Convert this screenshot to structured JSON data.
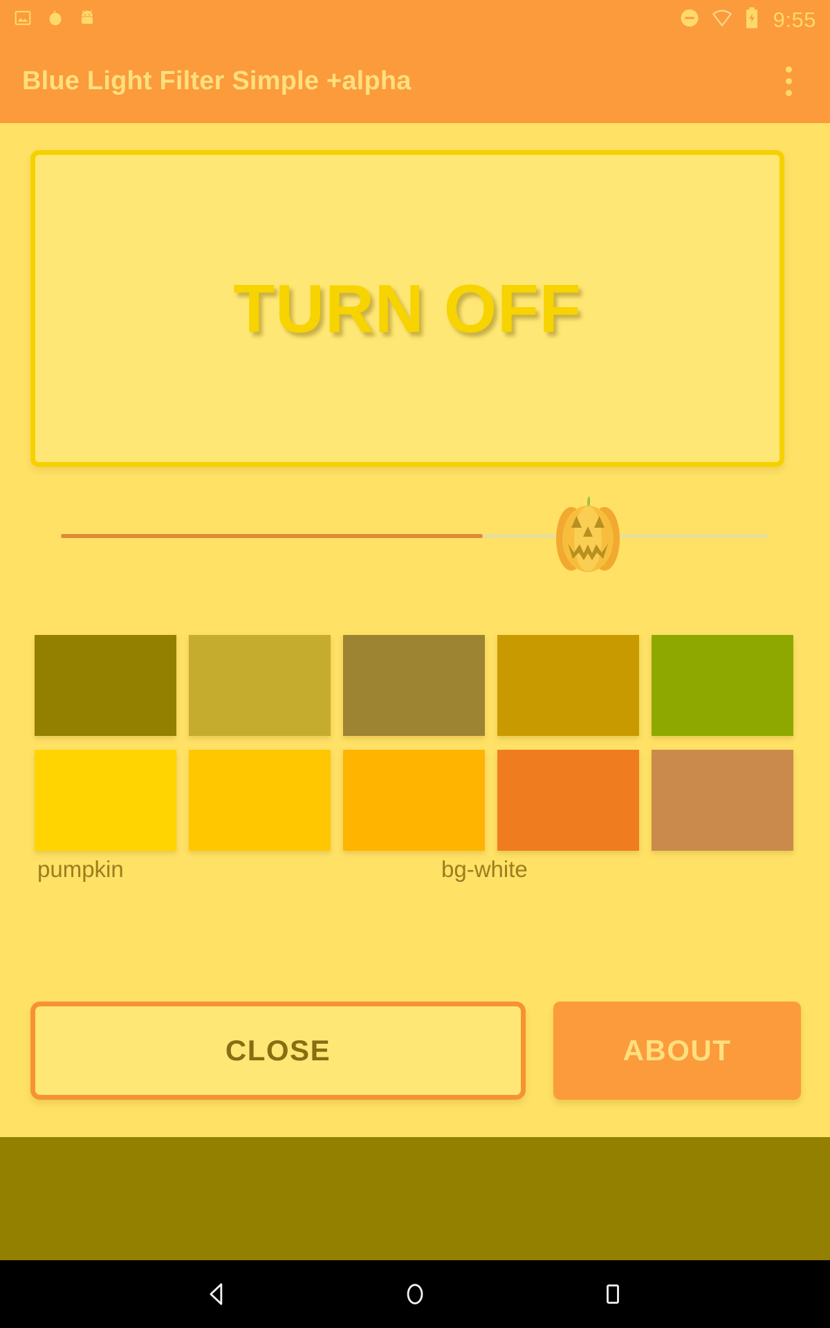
{
  "status_bar": {
    "icons_left": [
      "image-icon",
      "pumpkin-notification-icon",
      "android-robot-icon"
    ],
    "icons_right": [
      "do-not-disturb-icon",
      "wifi-icon",
      "battery-charging-icon"
    ],
    "time": "9:55"
  },
  "app_bar": {
    "title": "Blue Light Filter Simple +alpha",
    "overflow_icon": "more-vert-icon"
  },
  "main": {
    "toggle_button_label": "TURN OFF",
    "slider": {
      "thumb_icon": "jack-o-lantern-icon",
      "fill_percent": 60,
      "fill_color": "#E08A38",
      "track_color": "#EADE93"
    },
    "swatches": [
      {
        "row": 1,
        "index": 0,
        "color": "#937F00"
      },
      {
        "row": 1,
        "index": 1,
        "color": "#C5AC2E"
      },
      {
        "row": 1,
        "index": 2,
        "color": "#9C8432"
      },
      {
        "row": 1,
        "index": 3,
        "color": "#C99A00"
      },
      {
        "row": 1,
        "index": 4,
        "color": "#8EA800"
      },
      {
        "row": 2,
        "index": 0,
        "color": "#FFD400"
      },
      {
        "row": 2,
        "index": 1,
        "color": "#FFC700"
      },
      {
        "row": 2,
        "index": 2,
        "color": "#FFB400"
      },
      {
        "row": 2,
        "index": 3,
        "color": "#EF7D20"
      },
      {
        "row": 2,
        "index": 4,
        "color": "#C98A4B"
      }
    ],
    "labels": {
      "pumpkin": "pumpkin",
      "bg_white": "bg-white"
    },
    "buttons": {
      "close": "CLOSE",
      "about": "ABOUT"
    }
  },
  "nav_bar": {
    "back": "back-triangle-icon",
    "home": "home-circle-icon",
    "recents": "recents-square-icon"
  },
  "colors": {
    "accent_orange": "#FB9B3C",
    "background_yellow": "#FFE166",
    "panel_yellow": "#FFE775",
    "border_yellow": "#F6D100",
    "filter_overlay": "#937F00",
    "title_text": "#FFDF7E"
  }
}
